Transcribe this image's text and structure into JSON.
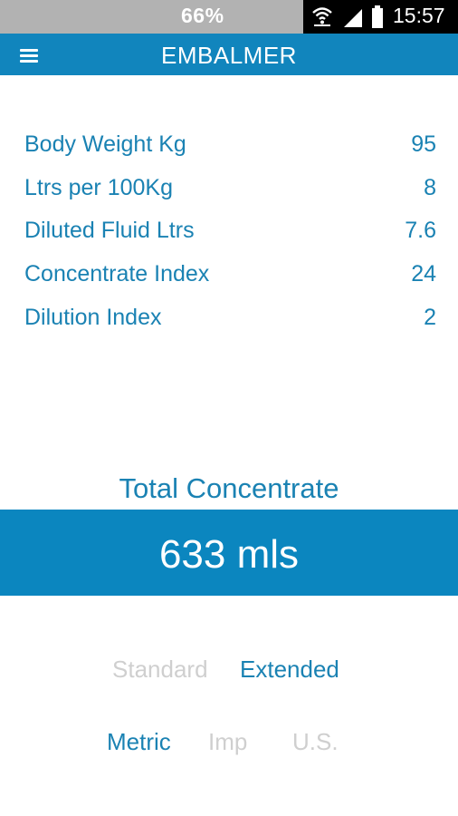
{
  "status_bar": {
    "battery_percent": "66%",
    "time": "15:57",
    "icons": [
      "wifi-icon",
      "signal-icon",
      "battery-icon"
    ]
  },
  "app_bar": {
    "title": "EMBALMER",
    "menu_icon": "menu-icon"
  },
  "params": [
    {
      "label": "Body Weight Kg",
      "value": "95"
    },
    {
      "label": "Ltrs per 100Kg",
      "value": "8"
    },
    {
      "label": "Diluted Fluid Ltrs",
      "value": "7.6"
    },
    {
      "label": "Concentrate Index",
      "value": "24"
    },
    {
      "label": "Dilution Index",
      "value": "2"
    }
  ],
  "total": {
    "label": "Total Concentrate",
    "value": "633 mls"
  },
  "mode_toggle": {
    "standard": "Standard",
    "extended": "Extended",
    "selected": "Extended"
  },
  "unit_toggle": {
    "metric": "Metric",
    "imp": "Imp",
    "us": "U.S.",
    "selected": "Metric"
  },
  "colors": {
    "accent": "#1185bd",
    "text_accent": "#1a82b3",
    "inactive": "#cfcfcf"
  }
}
